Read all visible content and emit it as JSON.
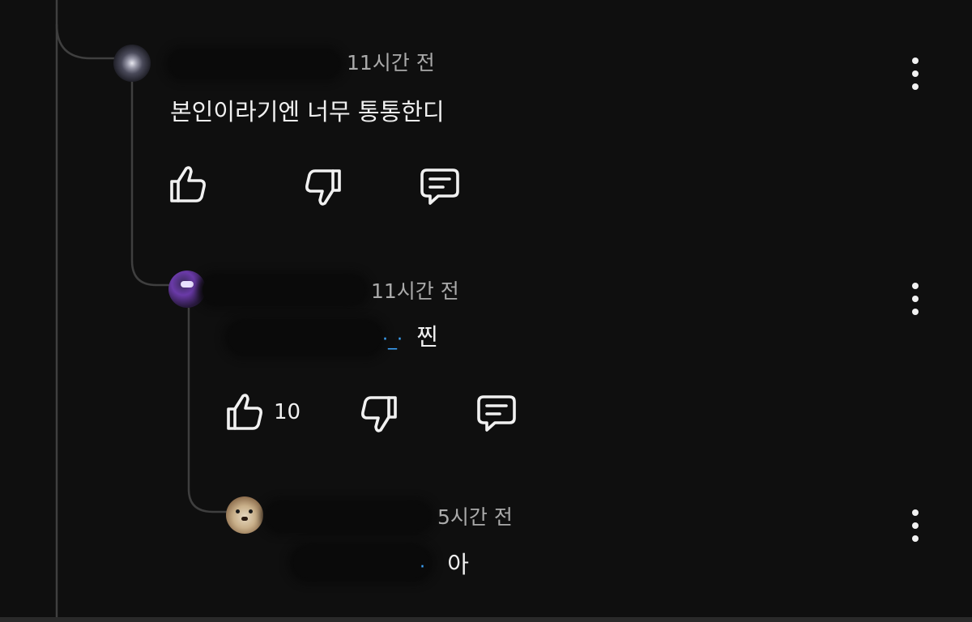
{
  "comments": [
    {
      "time": "11시간 전",
      "text": "본인이라기엔 너무 통통한디",
      "like_count": "",
      "avatar": "galaxy-avatar"
    },
    {
      "time": "11시간 전",
      "text_mark": "·_·",
      "text": "찐",
      "like_count": "10",
      "avatar": "purple-character-avatar"
    },
    {
      "time": "5시간 전",
      "text_mark": "·",
      "text": "아",
      "like_count": "",
      "avatar": "otter-avatar"
    }
  ],
  "icons": {
    "like": "thumbs-up-icon",
    "dislike": "thumbs-down-icon",
    "reply": "reply-comment-icon",
    "more": "more-vertical-icon"
  },
  "colors": {
    "background": "#0f0f0f",
    "text": "#f1f1f1",
    "meta": "#aaaaaa",
    "thread_line": "#3f3f3f",
    "accent": "#3ea6ff"
  }
}
